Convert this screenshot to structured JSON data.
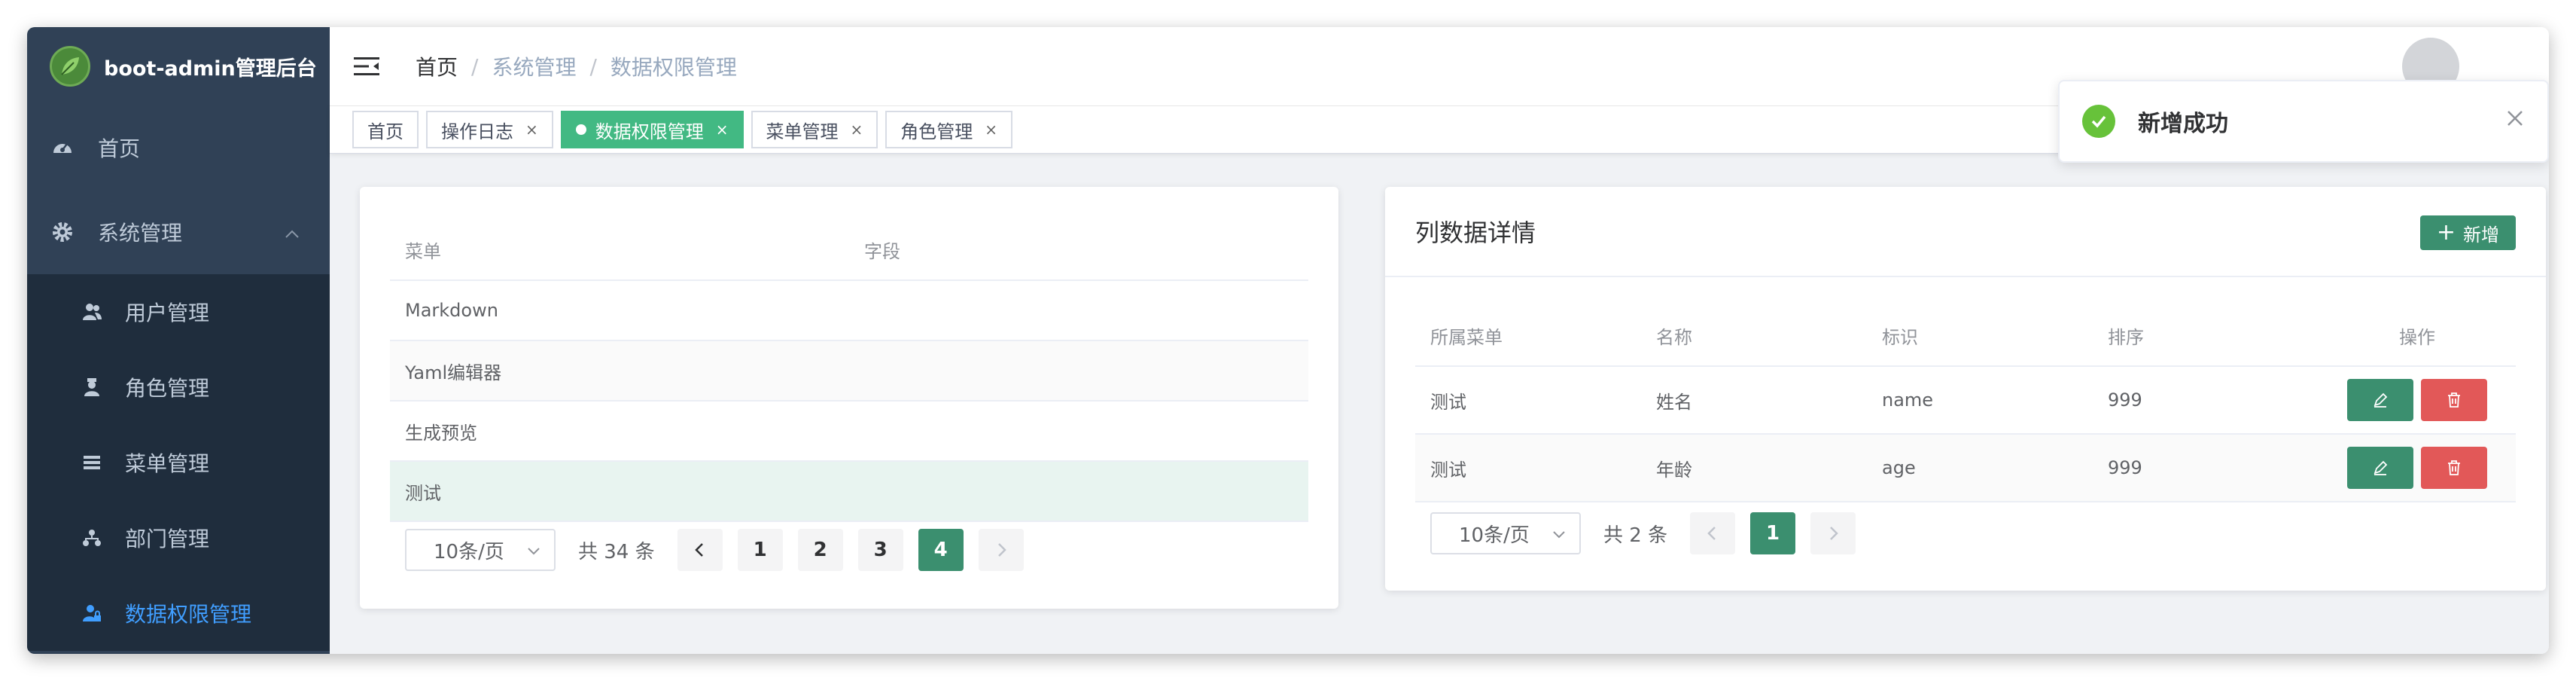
{
  "sidebar": {
    "logo_title": "boot-admin管理后台",
    "items": [
      {
        "label": "首页",
        "icon": "dashboard-icon"
      },
      {
        "label": "系统管理",
        "icon": "gear-icon"
      }
    ],
    "subitems": [
      {
        "label": "用户管理",
        "icon": "users-icon"
      },
      {
        "label": "角色管理",
        "icon": "role-icon"
      },
      {
        "label": "菜单管理",
        "icon": "list-icon"
      },
      {
        "label": "部门管理",
        "icon": "org-icon"
      },
      {
        "label": "数据权限管理",
        "icon": "permission-icon"
      }
    ],
    "active_color": "#409eff"
  },
  "breadcrumb": [
    "首页",
    "系统管理",
    "数据权限管理"
  ],
  "tags": [
    {
      "label": "首页",
      "x": ""
    },
    {
      "label": "操作日志",
      "x": "×"
    },
    {
      "label": "数据权限管理",
      "x": "×"
    },
    {
      "label": "菜单管理",
      "x": "×"
    },
    {
      "label": "角色管理",
      "x": "×"
    }
  ],
  "left_table": {
    "headers": [
      "菜单",
      "字段"
    ],
    "rows": [
      "Markdown",
      "Yaml编辑器",
      "生成预览",
      "测试"
    ],
    "page_size": "10条/页",
    "total": "共 34 条",
    "pages": [
      "1",
      "2",
      "3",
      "4"
    ],
    "current_page": "4"
  },
  "right_card": {
    "title": "列数据详情",
    "add_label": "新增",
    "headers": [
      "所属菜单",
      "名称",
      "标识",
      "排序",
      "操作"
    ],
    "rows": [
      [
        "测试",
        "姓名",
        "name",
        "999"
      ],
      [
        "测试",
        "年龄",
        "age",
        "999"
      ]
    ],
    "page_size": "10条/页",
    "total": "共 2 条",
    "pages": [
      "1"
    ]
  },
  "toast": {
    "message": "新增成功",
    "icon": "success-check-icon"
  },
  "colors": {
    "sidebar": "#304156",
    "primary_green": "#3b8f6f",
    "tag_active": "#42b983",
    "danger": "#e25858"
  }
}
